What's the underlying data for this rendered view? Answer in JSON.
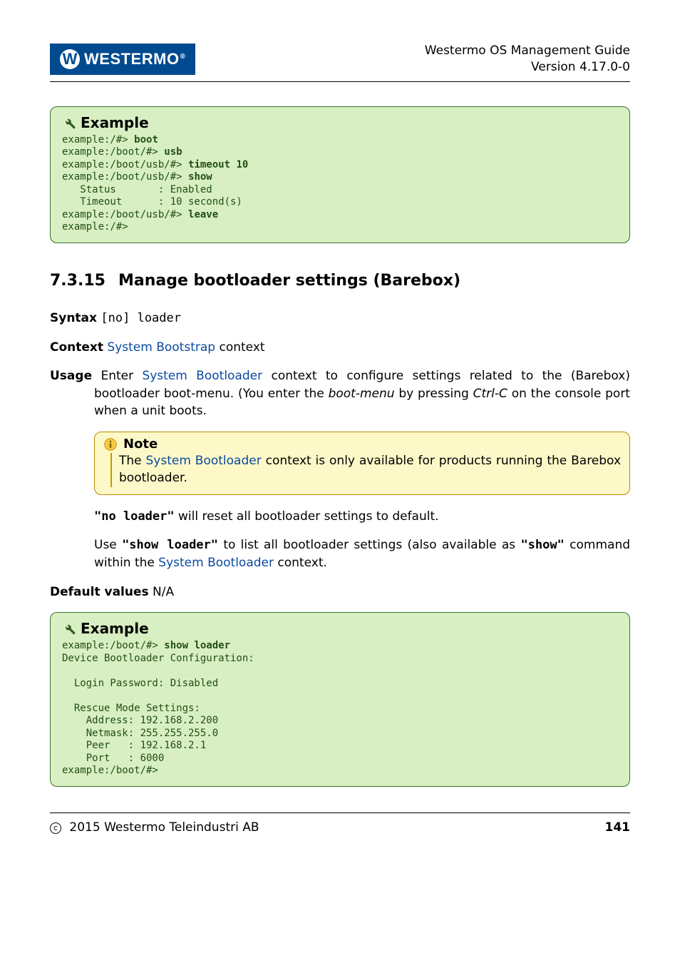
{
  "header": {
    "logo_w": "W",
    "logo_text": "WESTERMO",
    "logo_reg": "®",
    "title_line1": "Westermo OS Management Guide",
    "title_line2": "Version 4.17.0-0"
  },
  "example1": {
    "title": "Example",
    "l1_prompt": "example:/#> ",
    "l1_cmd": "boot",
    "l2_prompt": "example:/boot/#> ",
    "l2_cmd": "usb",
    "l3_prompt": "example:/boot/usb/#> ",
    "l3_cmd": "timeout 10",
    "l4_prompt": "example:/boot/usb/#> ",
    "l4_cmd": "show",
    "l5": "   Status       : Enabled",
    "l6": "   Timeout      : 10 second(s)",
    "l7_prompt": "example:/boot/usb/#> ",
    "l7_cmd": "leave",
    "l8": "example:/#>"
  },
  "section": {
    "number": "7.3.15",
    "title": "Manage bootloader settings (Barebox)"
  },
  "syntax": {
    "label": "Syntax",
    "value": "[no] loader"
  },
  "context": {
    "label": "Context",
    "link": "System Bootstrap",
    "after": " context"
  },
  "usage": {
    "label": "Usage",
    "t1a": "Enter ",
    "t1_link": "System Bootloader",
    "t1b": " context to configure settings related to the (Barebox) bootloader boot-menu.  (You enter the ",
    "t1_em": "boot-menu",
    "t1c": " by pressing ",
    "t1_em2": "Ctrl-C",
    "t1d": " on the console port when a unit boots."
  },
  "note": {
    "title": "Note",
    "t_a": "The ",
    "t_link": "System Bootloader",
    "t_b": " context is only available for products running the Barebox bootloader."
  },
  "para_no_loader": {
    "cmd": "\"no loader\"",
    "after": " will reset all bootloader settings to default."
  },
  "para_show": {
    "a": "Use ",
    "cmd1": "\"show loader\"",
    "b": " to list all bootloader settings (also available as ",
    "cmd2": "\"show\"",
    "c": " command within the ",
    "link": "System Bootloader",
    "d": " context."
  },
  "default_values": {
    "label": "Default values",
    "value": "N/A"
  },
  "example2": {
    "title": "Example",
    "l1_prompt": "example:/boot/#> ",
    "l1_cmd": "show loader",
    "l2": "Device Bootloader Configuration:",
    "l3": "",
    "l4": "  Login Password: Disabled",
    "l5": "",
    "l6": "  Rescue Mode Settings:",
    "l7": "    Address: 192.168.2.200",
    "l8": "    Netmask: 255.255.255.0",
    "l9": "    Peer   : 192.168.2.1",
    "l10": "    Port   : 6000",
    "l11": "example:/boot/#>"
  },
  "footer": {
    "copyright": "2015 Westermo Teleindustri AB",
    "page": "141"
  }
}
